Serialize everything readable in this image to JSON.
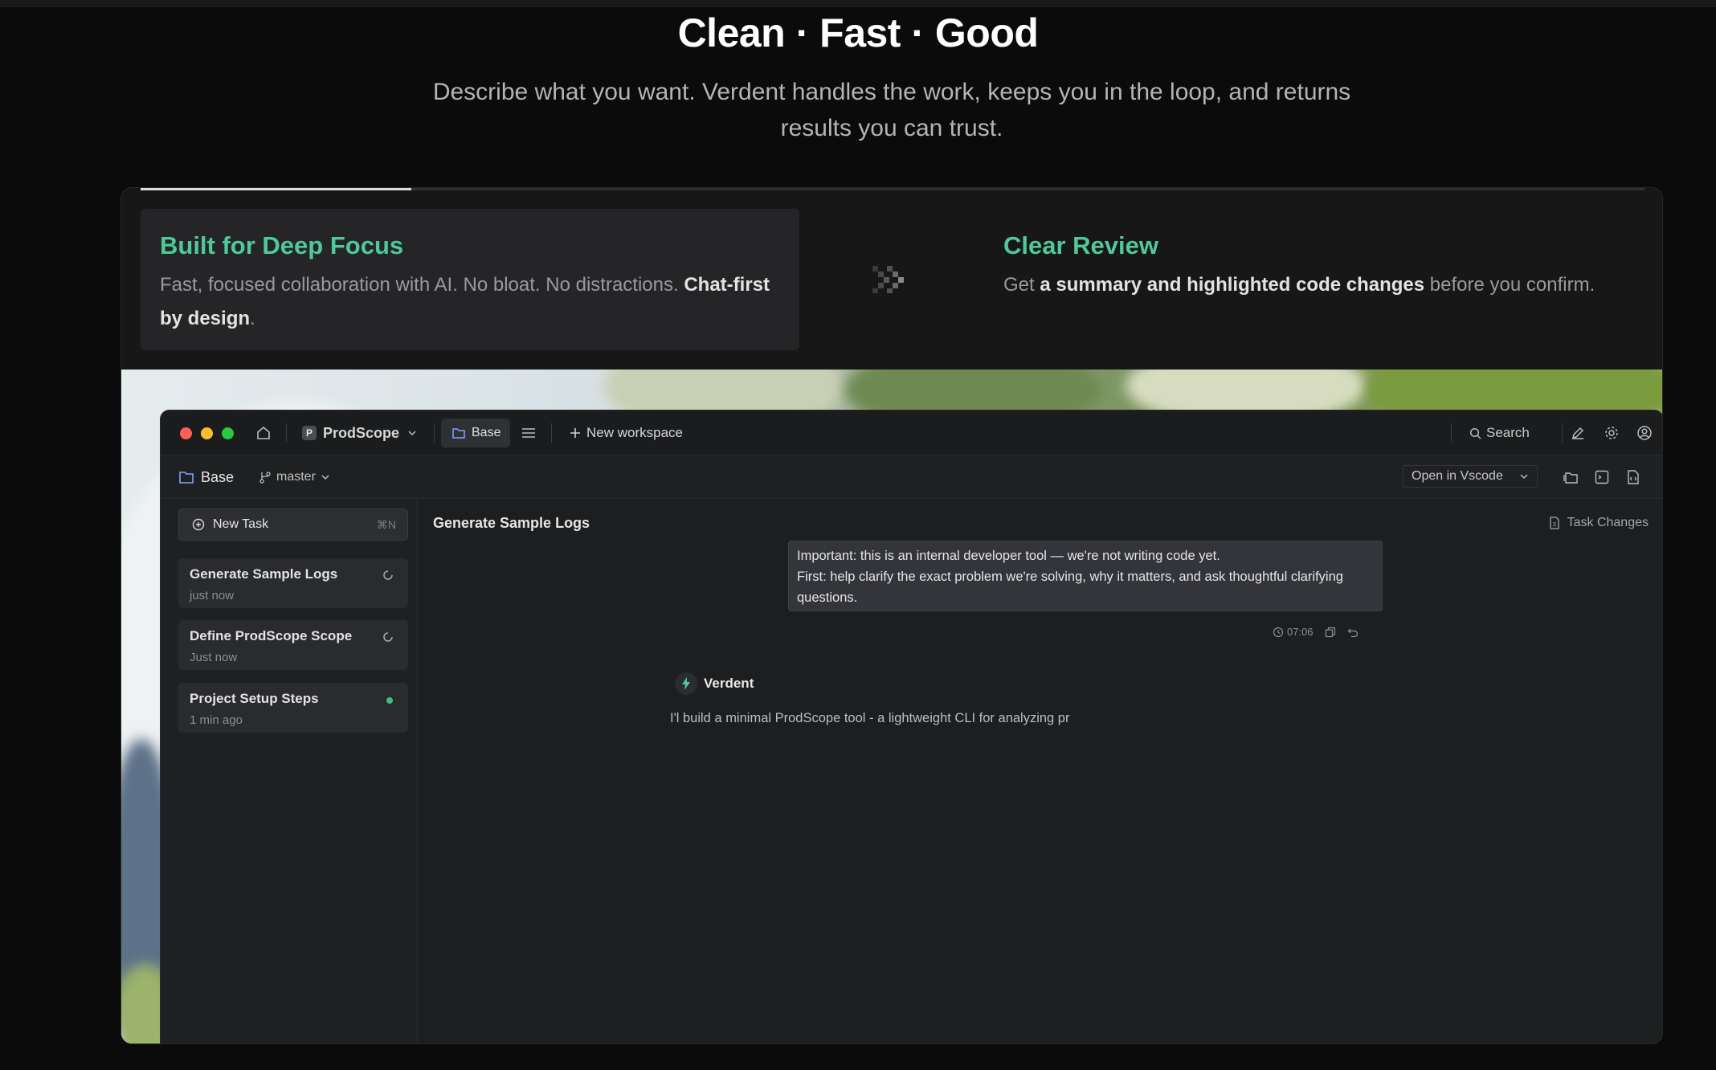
{
  "hero": {
    "title": "Clean · Fast · Good",
    "subtitle": "Describe what you want. Verdent handles the work, keeps you in the loop, and returns results you can trust."
  },
  "carousel": {
    "progress": 0.18,
    "features": [
      {
        "title": "Built for Deep Focus",
        "text_before": "Fast, focused collaboration with AI. No bloat. No distractions. ",
        "text_bold": "Chat-first by design",
        "text_after": "."
      },
      {
        "title": "Clear Review",
        "text_before": "Get ",
        "text_bold": "a summary and highlighted code changes",
        "text_after": " before you confirm."
      }
    ]
  },
  "colors": {
    "accent": "#4fc99a",
    "close": "#ff5f57",
    "minimize": "#febc2e",
    "maximize": "#28c840",
    "status_done": "#3fbf7f"
  },
  "app": {
    "project_name": "ProdScope",
    "project_initial": "P",
    "base_tab": "Base",
    "new_workspace": "New workspace",
    "search": "Search",
    "workspace_name": "Base",
    "branch": "master",
    "open_in": "Open in Vscode",
    "new_task": {
      "label": "New Task",
      "shortcut": "⌘N"
    },
    "tasks": [
      {
        "title": "Generate Sample Logs",
        "time": "just now",
        "status": "running"
      },
      {
        "title": "Define ProdScope Scope",
        "time": "Just now",
        "status": "running"
      },
      {
        "title": "Project Setup Steps",
        "time": "1 min ago",
        "status": "done"
      }
    ],
    "main": {
      "title": "Generate Sample Logs",
      "task_changes": "Task Changes",
      "user_message": {
        "line1": "Important: this is an internal developer tool — we're not writing code yet.",
        "line2": "First: help clarify the exact problem we're solving, why it matters, and ask thoughtful clarifying questions."
      },
      "message_time": "07:06",
      "agent_name": "Verdent",
      "agent_text": "I'l build a minimal ProdScope tool - a lightweight CLI for analyzing pr"
    }
  }
}
